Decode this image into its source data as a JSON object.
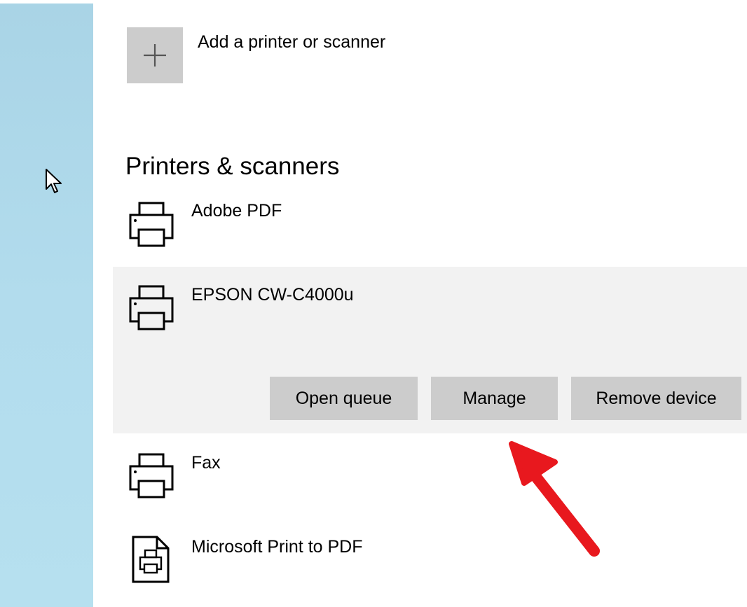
{
  "add_device": {
    "label": "Add a printer or scanner",
    "icon": "plus-icon"
  },
  "section": {
    "title": "Printers & scanners"
  },
  "devices": [
    {
      "name": "Adobe PDF",
      "icon": "printer-icon"
    },
    {
      "name": "EPSON CW-C4000u",
      "icon": "printer-icon",
      "selected": true
    },
    {
      "name": "Fax",
      "icon": "printer-icon"
    },
    {
      "name": "Microsoft Print to PDF",
      "icon": "pdf-printer-icon"
    }
  ],
  "selected_actions": {
    "open_queue": "Open queue",
    "manage": "Manage",
    "remove_device": "Remove device"
  },
  "colors": {
    "accent_arrow": "#e8181e",
    "tile_gray": "#cccccc",
    "selected_bg": "#f2f2f2",
    "left_strip": "#b2dced"
  }
}
